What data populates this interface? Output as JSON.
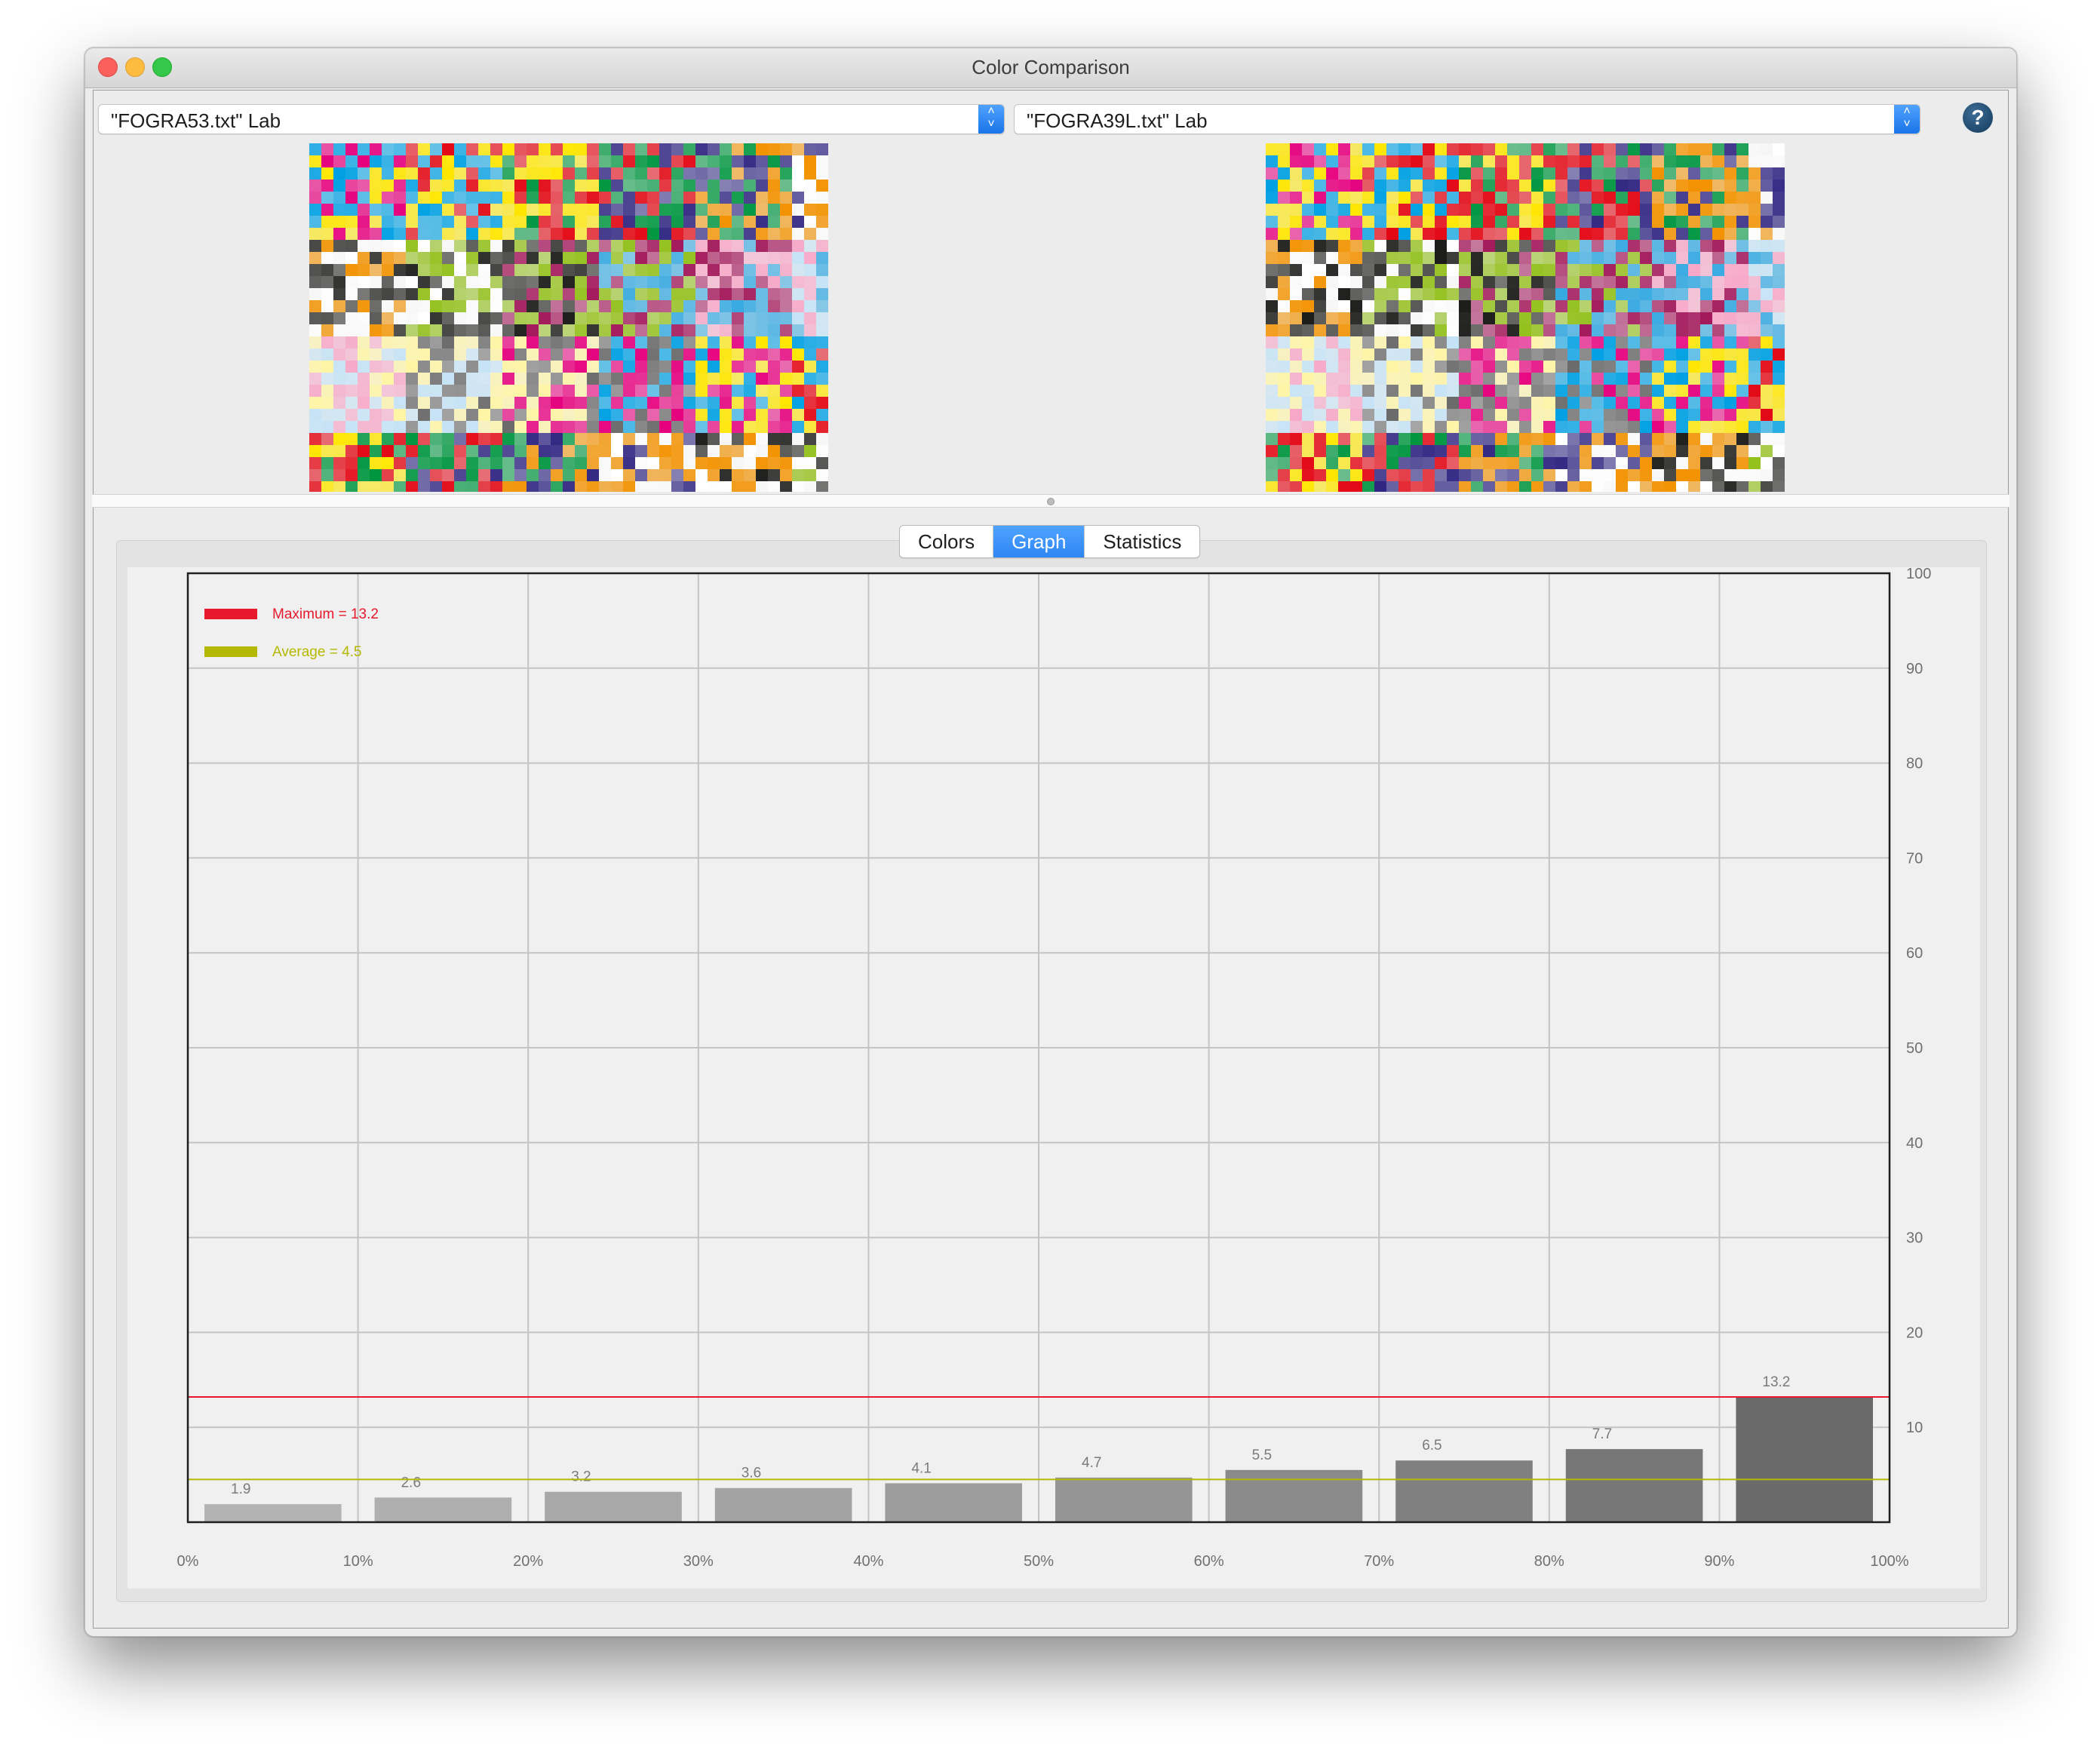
{
  "window": {
    "title": "Color Comparison"
  },
  "toolbar": {
    "left_source": "\"FOGRA53.txt\" Lab",
    "right_source": "\"FOGRA39L.txt\" Lab",
    "help_label": "?"
  },
  "tabs": [
    "Colors",
    "Graph",
    "Statistics"
  ],
  "active_tab": "Graph",
  "icons": {
    "close": "close-icon",
    "minimize": "minimize-icon",
    "zoom": "zoom-icon",
    "popup_arrows": "updown-chevron-icon",
    "help": "help-icon"
  },
  "colors": {
    "accent": "#2f86f5",
    "max_line": "#e8192c",
    "avg_line": "#b5b800"
  },
  "chart_data": {
    "type": "bar",
    "categories": [
      "0%-10%",
      "10%-20%",
      "20%-30%",
      "30%-40%",
      "40%-50%",
      "50%-60%",
      "60%-70%",
      "70%-80%",
      "80%-90%",
      "90%-100%"
    ],
    "values": [
      1.9,
      2.6,
      3.2,
      3.6,
      4.1,
      4.7,
      5.5,
      6.5,
      7.7,
      13.2
    ],
    "value_labels": [
      "1.9",
      "2.6",
      "3.2",
      "3.6",
      "4.1",
      "4.7",
      "5.5",
      "6.5",
      "7.7",
      "13.2"
    ],
    "x_ticks": [
      "0%",
      "10%",
      "20%",
      "30%",
      "40%",
      "50%",
      "60%",
      "70%",
      "80%",
      "90%",
      "100%"
    ],
    "y_ticks": [
      "10",
      "20",
      "30",
      "40",
      "50",
      "60",
      "70",
      "80",
      "90",
      "100"
    ],
    "ylim": [
      0,
      100
    ],
    "y_axis_side": "right",
    "grid": true,
    "maximum": 13.2,
    "average": 4.5,
    "legend": [
      {
        "label": "Maximum = 13.2",
        "color": "#e8192c"
      },
      {
        "label": "Average =  4.5",
        "color": "#b5b800"
      }
    ],
    "legend_position": "top-left",
    "bar_colors": [
      "#b3b3b3",
      "#afafaf",
      "#a8a8a8",
      "#a3a3a3",
      "#9c9c9c",
      "#959595",
      "#8a8a8a",
      "#808080",
      "#777777",
      "#6a6a6a"
    ]
  }
}
